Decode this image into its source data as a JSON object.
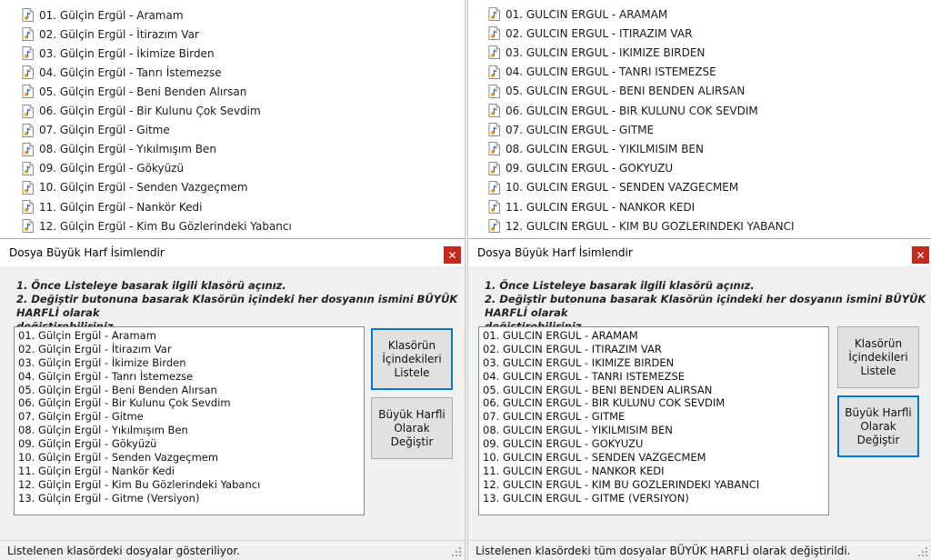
{
  "left": {
    "explorer_files": [
      "01. Gülçin Ergül - Aramam",
      "02. Gülçin Ergül - İtirazım Var",
      "03. Gülçin Ergül - İkimize Birden",
      "04. Gülçin Ergül - Tanrı İstemezse",
      "05. Gülçin Ergül - Beni Benden Alırsan",
      "06. Gülçin Ergül - Bir Kulunu Çok Sevdim",
      "07. Gülçin Ergül - Gitme",
      "08. Gülçin Ergül - Yıkılmışım Ben",
      "09. Gülçin Ergül - Gökyüzü",
      "10. Gülçin Ergül - Senden Vazgeçmem",
      "11. Gülçin Ergül - Nankör Kedi",
      "12. Gülçin Ergül - Kim Bu Gözlerindeki Yabancı"
    ],
    "window_title": "Dosya Büyük Harf İsimlendir",
    "close_glyph": "✕",
    "instruction_1": "1. Önce Listeleye basarak ilgili klasörü açınız.",
    "instruction_2": "2. Değiştir butonuna basarak Klasörün içindeki her dosyanın ismini BÜYÜK HARFLİ olarak",
    "instruction_3": "değiştirebiliriniz.",
    "list_items": [
      "01. Gülçin Ergül - Aramam",
      "02. Gülçin Ergül - İtirazım Var",
      "03. Gülçin Ergül - İkimize Birden",
      "04. Gülçin Ergül - Tanrı İstemezse",
      "05. Gülçin Ergül - Beni Benden Alırsan",
      "06. Gülçin Ergül - Bir Kulunu Çok Sevdim",
      "07. Gülçin Ergül - Gitme",
      "08. Gülçin Ergül - Yıkılmışım Ben",
      "09. Gülçin Ergül - Gökyüzü",
      "10. Gülçin Ergül - Senden Vazgeçmem",
      "11. Gülçin Ergül - Nankör Kedi",
      "12. Gülçin Ergül - Kim Bu Gözlerindeki Yabancı",
      "13. Gülçin Ergül - Gitme (Versiyon)"
    ],
    "btn_list_label": "Klasörün İçindekileri Listele",
    "btn_upper_label": "Büyük Harfli Olarak Değiştir",
    "focused_button": "list",
    "status_text": "Listelenen klasördeki dosyalar gösteriliyor."
  },
  "right": {
    "explorer_files": [
      "01. GULCIN ERGUL - ARAMAM",
      "02. GULCIN ERGUL - ITIRAZIM VAR",
      "03. GULCIN ERGUL - IKIMIZE BIRDEN",
      "04. GULCIN ERGUL - TANRI ISTEMEZSE",
      "05. GULCIN ERGUL - BENI BENDEN ALIRSAN",
      "06. GULCIN ERGUL - BIR KULUNU COK SEVDIM",
      "07. GULCIN ERGUL - GITME",
      "08. GULCIN ERGUL - YIKILMISIM BEN",
      "09. GULCIN ERGUL - GOKYUZU",
      "10. GULCIN ERGUL - SENDEN VAZGECMEM",
      "11. GULCIN ERGUL - NANKOR KEDI",
      "12. GULCIN ERGUL - KIM BU GOZLERINDEKI YABANCI"
    ],
    "window_title": "Dosya Büyük Harf İsimlendir",
    "close_glyph": "✕",
    "instruction_1": "1. Önce Listeleye basarak ilgili klasörü açınız.",
    "instruction_2": "2. Değiştir butonuna basarak Klasörün içindeki her dosyanın ismini BÜYÜK HARFLİ olarak",
    "instruction_3": "değiştirebiliriniz.",
    "list_items": [
      "01. GULCIN ERGUL - ARAMAM",
      "02. GULCIN ERGUL - ITIRAZIM VAR",
      "03. GULCIN ERGUL - IKIMIZE BIRDEN",
      "04. GULCIN ERGUL - TANRI ISTEMEZSE",
      "05. GULCIN ERGUL - BENI BENDEN ALIRSAN",
      "06. GULCIN ERGUL - BIR KULUNU COK SEVDIM",
      "07. GULCIN ERGUL - GITME",
      "08. GULCIN ERGUL - YIKILMISIM BEN",
      "09. GULCIN ERGUL - GOKYUZU",
      "10. GULCIN ERGUL - SENDEN VAZGECMEM",
      "11. GULCIN ERGUL - NANKOR KEDI",
      "12. GULCIN ERGUL - KIM BU GOZLERINDEKI YABANCI",
      "13. GULCIN ERGUL - GITME (VERSIYON)"
    ],
    "btn_list_label": "Klasörün İçindekileri Listele",
    "btn_upper_label": "Büyük Harfli Olarak Değiştir",
    "focused_button": "upper",
    "status_text": "Listelenen klasördeki tüm dosyalar BÜYÜK HARFLİ olarak değiştirildi."
  },
  "colors": {
    "focus_border": "#0078d7",
    "close_button": "#c42b1c",
    "window_bg": "#f0f0f0"
  },
  "icons": {
    "file": "audio-file-icon",
    "close": "close-icon",
    "grip": "resize-grip-icon"
  }
}
